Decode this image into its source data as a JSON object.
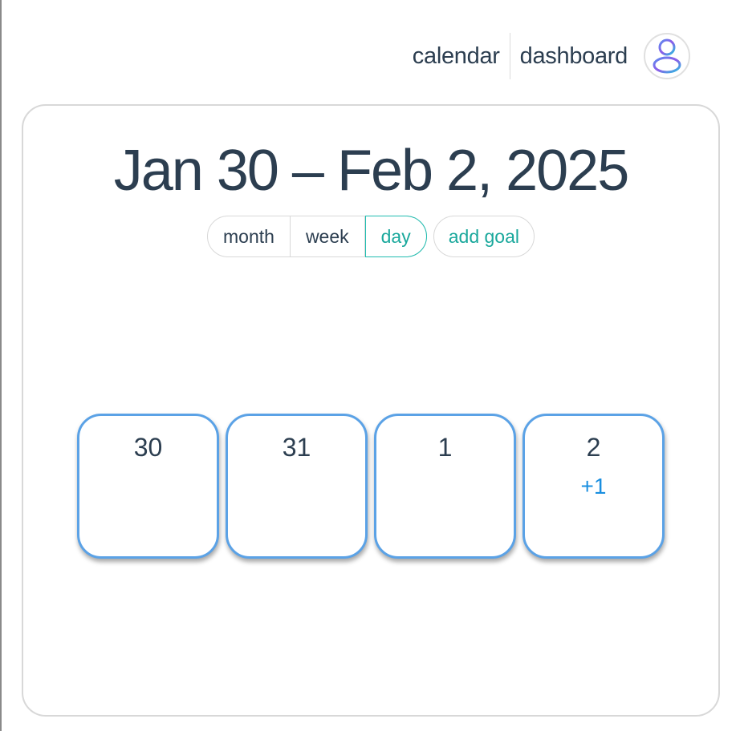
{
  "nav": {
    "calendar_label": "calendar",
    "dashboard_label": "dashboard",
    "avatar_icon": "user-icon"
  },
  "header": {
    "range_title": "Jan 30 – Feb 2, 2025"
  },
  "view_switcher": {
    "options": [
      "month",
      "week",
      "day"
    ],
    "selected": "day",
    "add_goal_label": "add goal"
  },
  "days": [
    {
      "day": "30",
      "more": ""
    },
    {
      "day": "31",
      "more": ""
    },
    {
      "day": "1",
      "more": ""
    },
    {
      "day": "2",
      "more": "+1"
    }
  ],
  "colors": {
    "accent": "#1aa89c",
    "cell_border": "#5ba2e6",
    "more_badge": "#1a8fe0",
    "text": "#2c3e50"
  }
}
